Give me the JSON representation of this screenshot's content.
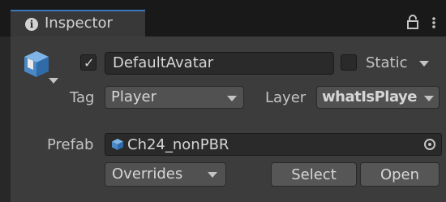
{
  "tab": {
    "title": "Inspector"
  },
  "gameobject": {
    "active_checked": true,
    "name": "DefaultAvatar",
    "static_label": "Static",
    "static_checked": false,
    "tag_label": "Tag",
    "tag_value": "Player",
    "layer_label": "Layer",
    "layer_value": "whatIsPlaye"
  },
  "prefab": {
    "label": "Prefab",
    "asset_name": "Ch24_nonPBR",
    "overrides_label": "Overrides",
    "select_label": "Select",
    "open_label": "Open"
  },
  "icons": [
    "info-icon",
    "lock-icon",
    "menu-icon",
    "gameobject-icon",
    "prefab-icon",
    "object-picker-icon"
  ],
  "colors": {
    "background": "#282828",
    "panel": "#3c3c3c",
    "tab_accent": "#3a79bb",
    "field": "#2a2a2a"
  }
}
